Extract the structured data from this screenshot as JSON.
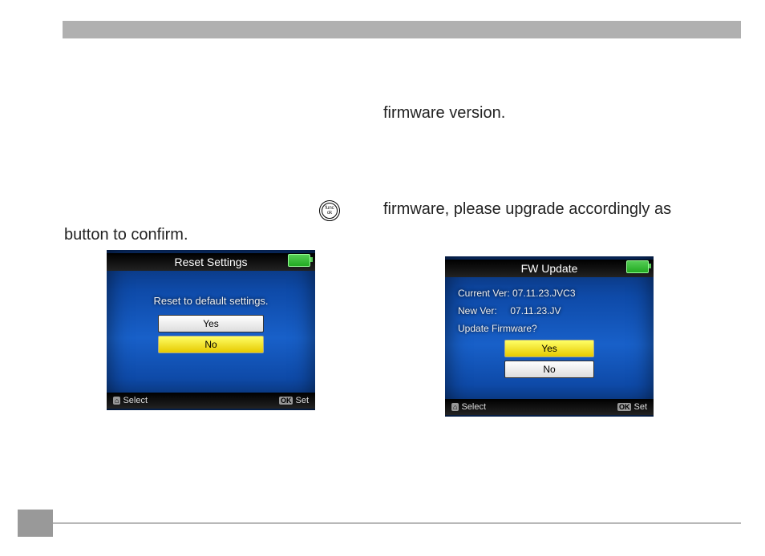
{
  "text": {
    "fw_version_frag": "firmware version.",
    "fw_upgrade_frag": "firmware, please upgrade accordingly as",
    "button_confirm": "button to confirm."
  },
  "icon": {
    "func_ok": "func\nok"
  },
  "screens": {
    "reset": {
      "title": "Reset Settings",
      "message": "Reset to default settings.",
      "yes": "Yes",
      "no": "No",
      "selected": "no",
      "hint_left": "Select",
      "hint_right": "Set",
      "hint_left_icon": "⌂",
      "hint_right_icon": "OK"
    },
    "fw": {
      "title": "FW Update",
      "line1": "Current Ver: 07.11.23.JVC3",
      "line2": "New Ver:     07.11.23.JV",
      "line3": "Update Firmware?",
      "yes": "Yes",
      "no": "No",
      "selected": "yes",
      "hint_left": "Select",
      "hint_right": "Set",
      "hint_left_icon": "⌂",
      "hint_right_icon": "OK"
    }
  },
  "page_number": ""
}
